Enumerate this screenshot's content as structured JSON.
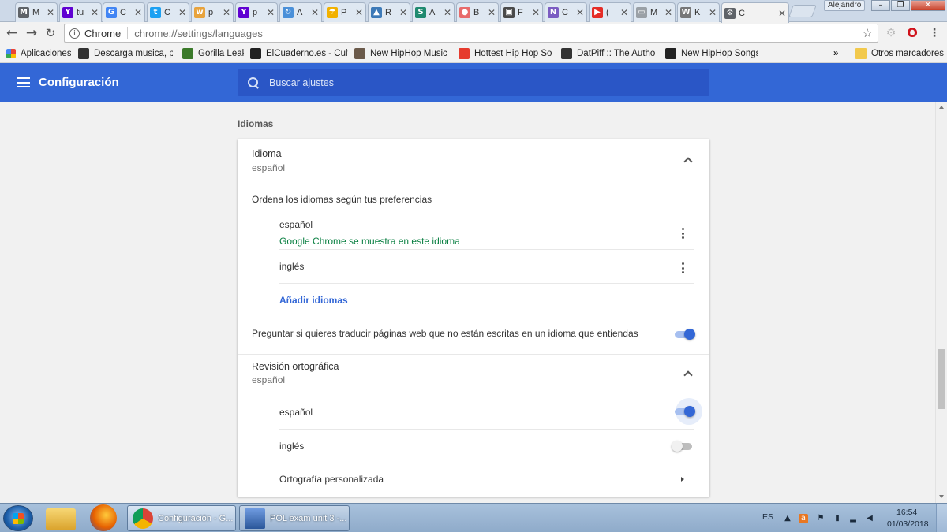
{
  "browser": {
    "tabs": [
      {
        "title": "M",
        "icon": "gmail-icon",
        "color": "#5f6368"
      },
      {
        "title": "tu",
        "icon": "yahoo-icon",
        "color": "#6001d2"
      },
      {
        "title": "C",
        "icon": "docs-icon",
        "color": "#4285f4"
      },
      {
        "title": "C",
        "icon": "twitter-icon",
        "color": "#1da1f2"
      },
      {
        "title": "p",
        "icon": "wordreference-icon",
        "color": "#e8a33d"
      },
      {
        "title": "p",
        "icon": "yahoo-icon",
        "color": "#6001d2"
      },
      {
        "title": "A",
        "icon": "chrome-update-icon",
        "color": "#4a90d9"
      },
      {
        "title": "P",
        "icon": "umbrella-icon",
        "color": "#f2b100"
      },
      {
        "title": "R",
        "icon": "image-icon",
        "color": "#3d7ab8"
      },
      {
        "title": "A",
        "icon": "skype-icon",
        "color": "#1f8a70"
      },
      {
        "title": "B",
        "icon": "asana-icon",
        "color": "#e86b6b"
      },
      {
        "title": "F",
        "icon": "photo-icon",
        "color": "#4a4a4a"
      },
      {
        "title": "C",
        "icon": "nz-icon",
        "color": "#7b5cc2"
      },
      {
        "title": "(",
        "icon": "youtube-icon",
        "color": "#e52d27"
      },
      {
        "title": "M",
        "icon": "document-icon",
        "color": "#9aa0a6"
      },
      {
        "title": "K",
        "icon": "wikipedia-icon",
        "color": "#777777"
      },
      {
        "title": "C",
        "icon": "settings-icon",
        "color": "#5f6368"
      }
    ],
    "profile_name": "Alejandro",
    "omnibox": {
      "chip": "Chrome",
      "url": "chrome://settings/languages"
    }
  },
  "bookmarks": {
    "apps_label": "Aplicaciones",
    "items": [
      {
        "label": "Descarga musica, pel",
        "icon": "car-icon",
        "color": "#333333"
      },
      {
        "label": "Gorilla Leak",
        "icon": "gorilla-icon",
        "color": "#3b7a2a"
      },
      {
        "label": "ElCuaderno.es - Cultu",
        "icon": "globe-icon",
        "color": "#222222"
      },
      {
        "label": "New HipHop Music D",
        "icon": "speaker-icon",
        "color": "#6b5a4a"
      },
      {
        "label": "Hottest Hip Hop Son",
        "icon": "hotnewhiphop-icon",
        "color": "#e63b2e"
      },
      {
        "label": "DatPiff :: The Authorit",
        "icon": "cassette-icon",
        "color": "#333333"
      },
      {
        "label": "New HipHop Songs,",
        "icon": "hiphop-icon",
        "color": "#222222"
      }
    ],
    "overflow": "»",
    "other_label": "Otros marcadores"
  },
  "settings": {
    "title": "Configuración",
    "search_placeholder": "Buscar ajustes",
    "section_title": "Idiomas",
    "language": {
      "title": "Idioma",
      "value": "español",
      "order_label": "Ordena los idiomas según tus preferencias",
      "languages": [
        {
          "name": "español",
          "note": "Google Chrome se muestra en este idioma"
        },
        {
          "name": "inglés",
          "note": ""
        }
      ],
      "add_label": "Añadir idiomas",
      "translate_label": "Preguntar si quieres traducir páginas web que no están escritas en un idioma que entiendas",
      "translate_enabled": true
    },
    "spellcheck": {
      "title": "Revisión ortográfica",
      "value": "español",
      "languages": [
        {
          "name": "español",
          "enabled": true
        },
        {
          "name": "inglés",
          "enabled": false
        }
      ],
      "custom_label": "Ortografía personalizada"
    },
    "accent_color": "#3367d6"
  },
  "taskbar": {
    "tasks": [
      {
        "label": "Configuración - G...",
        "icon": "chrome-icon"
      },
      {
        "label": "POL exam unit 3 -...",
        "icon": "word-icon"
      }
    ],
    "tray_lang": "ES",
    "time": "16:54",
    "date": "01/03/2018"
  }
}
